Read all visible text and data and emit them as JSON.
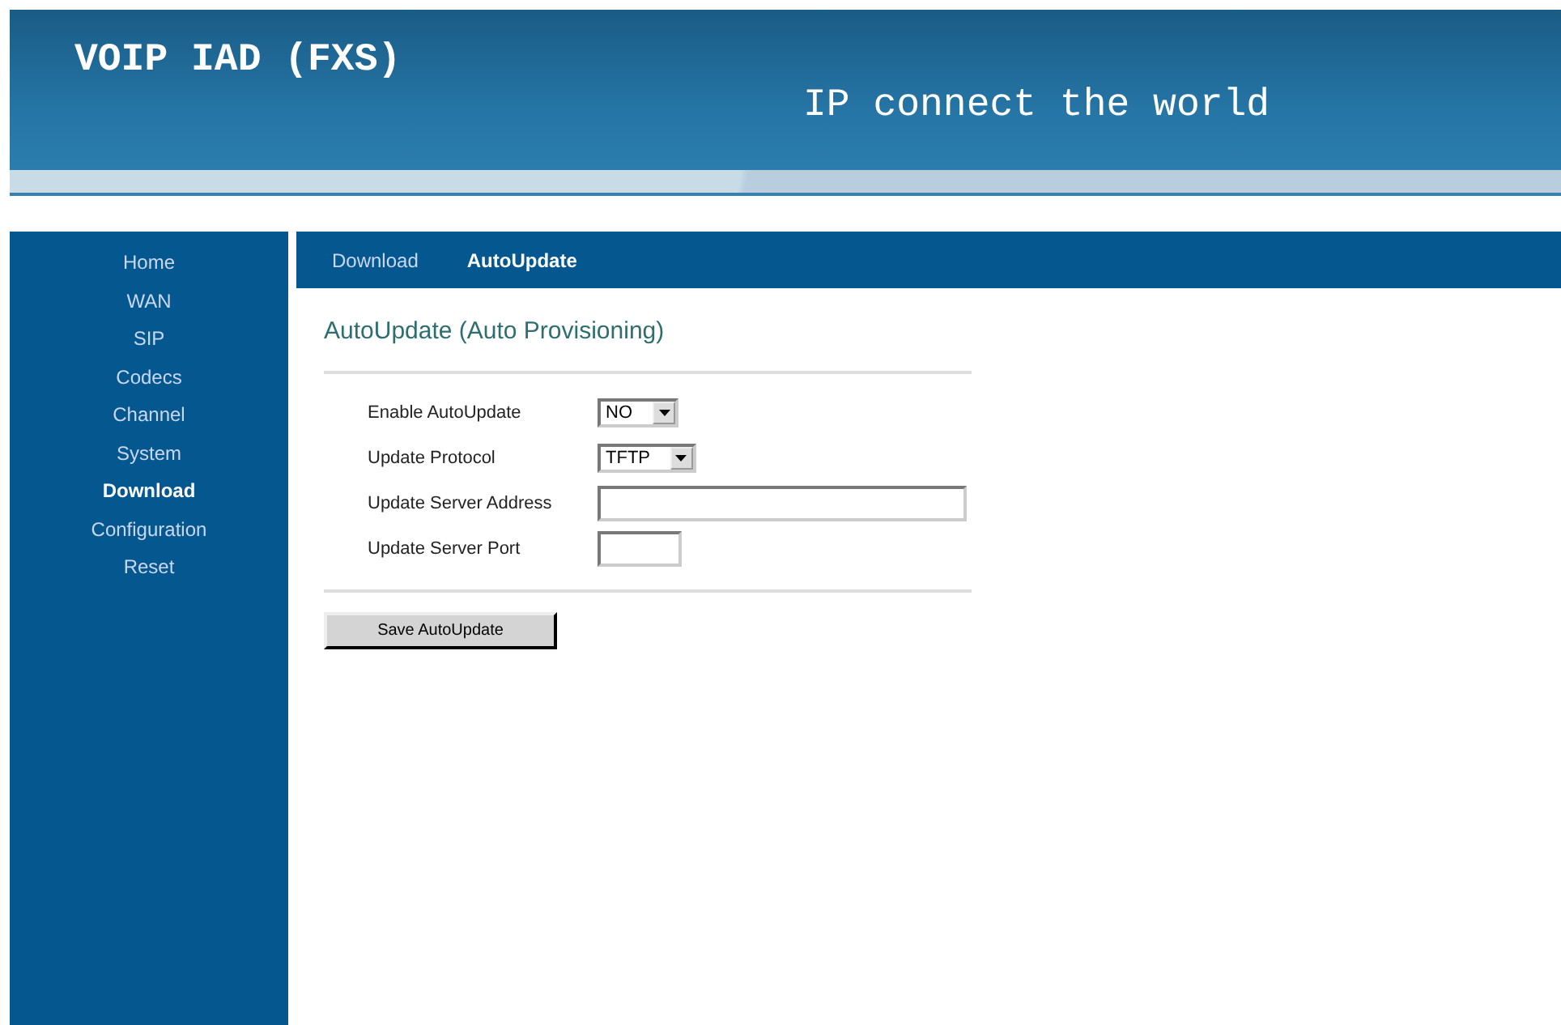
{
  "header": {
    "title": "VOIP IAD (FXS)",
    "slogan": "IP connect the world"
  },
  "sidebar": {
    "items": [
      {
        "label": "Home",
        "selected": false
      },
      {
        "label": "WAN",
        "selected": false
      },
      {
        "label": "SIP",
        "selected": false
      },
      {
        "label": "Codecs",
        "selected": false
      },
      {
        "label": "Channel",
        "selected": false
      },
      {
        "label": "System",
        "selected": false
      },
      {
        "label": "Download",
        "selected": true
      },
      {
        "label": "Configuration",
        "selected": false
      },
      {
        "label": "Reset",
        "selected": false
      }
    ]
  },
  "tabs": [
    {
      "label": "Download",
      "selected": false
    },
    {
      "label": "AutoUpdate",
      "selected": true
    }
  ],
  "heading": "AutoUpdate (Auto Provisioning)",
  "fields": [
    {
      "kind": "select",
      "label": "Enable AutoUpdate",
      "value": "NO"
    },
    {
      "kind": "select",
      "label": "Update Protocol",
      "value": "TFTP"
    },
    {
      "kind": "text",
      "label": "Update Server Address"
    },
    {
      "kind": "number",
      "label": "Update Server Port"
    }
  ],
  "save_button": "Save AutoUpdate"
}
